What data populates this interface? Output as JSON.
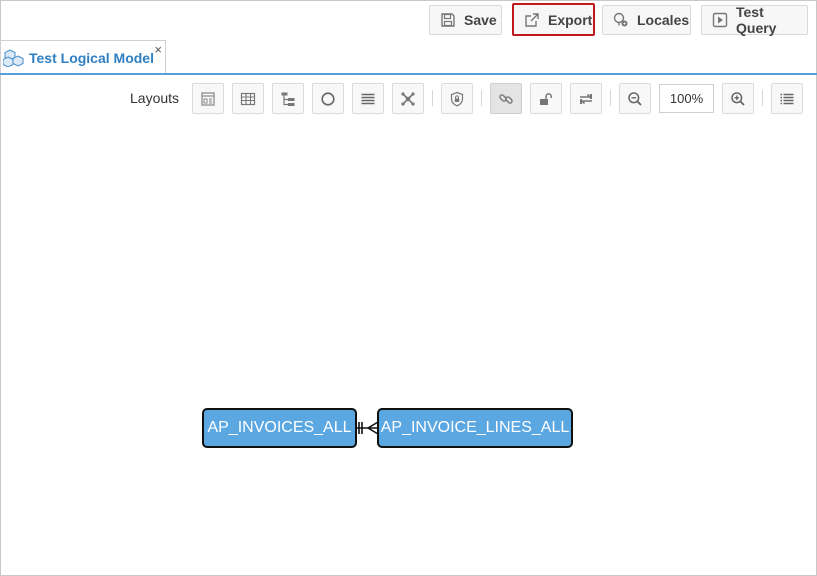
{
  "toolbar": {
    "save_label": "Save",
    "export_label": "Export",
    "locales_label": "Locales",
    "test_query_label": "Test Query"
  },
  "tab": {
    "title": "Test Logical Model",
    "close_glyph": "×"
  },
  "layouts": {
    "label": "Layouts",
    "zoom_value": "100%",
    "tools": [
      "layout-card-icon",
      "table-icon",
      "tree-icon",
      "circle-icon",
      "list-layout-icon",
      "organic-icon",
      "shield-icon",
      "link-icon",
      "unlock-icon",
      "swap-icon",
      "zoom-out-icon",
      "zoom-in-icon",
      "menu-list-icon"
    ]
  },
  "diagram": {
    "entities": [
      "AP_INVOICES_ALL",
      "AP_INVOICE_LINES_ALL"
    ]
  },
  "colors": {
    "accent": "#2f7fc2",
    "entity_fill": "#5ba7e2",
    "highlight": "#c0181e"
  }
}
